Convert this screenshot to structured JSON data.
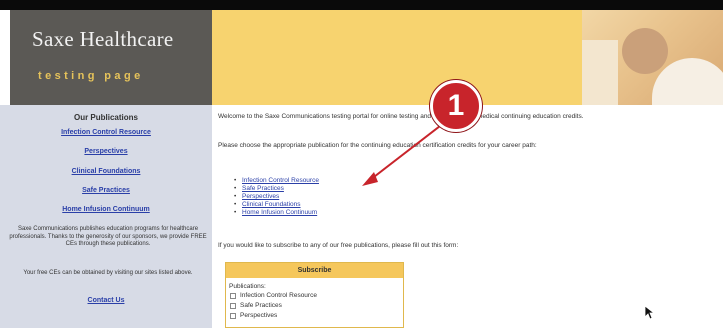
{
  "header": {
    "brand_title": "Saxe Healthcare",
    "brand_subtitle": "testing page"
  },
  "sidebar": {
    "heading": "Our Publications",
    "links": [
      "Infection Control Resource",
      "Perspectives",
      "Clinical Foundations",
      "Safe Practices",
      "Home Infusion Continuum"
    ],
    "blurb": "Saxe Communications publishes education programs for healthcare professionals. Thanks to the generosity of our sponsors, we provide FREE CEs through these publications.",
    "ces_note": "Your free CEs can be obtained by visiting our sites listed above.",
    "contact_label": "Contact Us"
  },
  "main": {
    "welcome": "Welcome to the Saxe Communications testing portal for online testing and certification for medical continuing education credits.",
    "choose": "Please choose the appropriate publication for the continuing education certification credits for your career path:",
    "publications": [
      "Infection Control Resource",
      "Safe Practices",
      "Perspectives",
      "Clinical Foundations",
      "Home Infusion Continuum"
    ],
    "subscribe_prompt": "If you would like to subscribe to any of our free publications, please fill out this form:"
  },
  "subscribe": {
    "title": "Subscribe",
    "publications_label": "Publications:",
    "options": [
      "Infection Control Resource",
      "Safe Practices",
      "Perspectives"
    ]
  },
  "annotation": {
    "step_number": "1",
    "color": "#c8242b"
  },
  "colors": {
    "banner": "#f7d36f",
    "sidebar_bg": "#d7dbe6",
    "link": "#2a3fa8",
    "subscribe_header": "#f5c75c"
  }
}
